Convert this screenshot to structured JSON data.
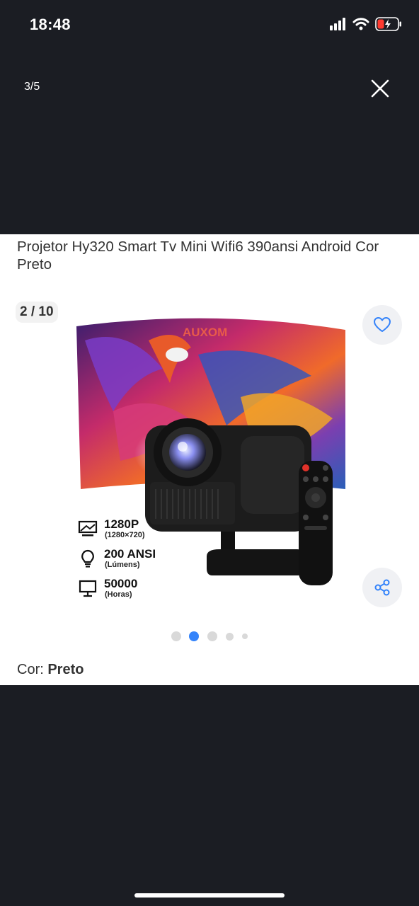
{
  "status_bar": {
    "time": "18:48"
  },
  "viewer": {
    "counter": "3/5"
  },
  "product": {
    "title": "Projetor Hy320 Smart Tv Mini Wifi6 390ansi Android Cor Preto",
    "image_counter": "2 / 10",
    "image_brand": "AUXOM",
    "specs": [
      {
        "main": "1280P",
        "sub": "(1280×720)",
        "icon": "screen-icon"
      },
      {
        "main": "200 ANSI",
        "sub": "(Lúmens)",
        "icon": "bulb-icon"
      },
      {
        "main": "50000",
        "sub": "(Horas)",
        "icon": "monitor-icon"
      }
    ],
    "carousel": {
      "count": 5,
      "active_index": 1
    },
    "color_label": "Cor: ",
    "color_value": "Preto"
  },
  "colors": {
    "accent": "#3483fa",
    "background": "#1b1d23",
    "card": "#ffffff"
  }
}
